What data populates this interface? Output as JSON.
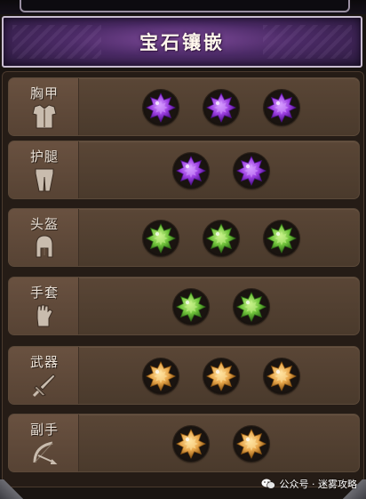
{
  "header": {
    "title": "宝石镶嵌"
  },
  "slots": [
    {
      "name": "胸甲",
      "icon": "chest-armor-icon",
      "gems": [
        "purple",
        "purple",
        "purple"
      ]
    },
    {
      "name": "护腿",
      "icon": "leg-armor-icon",
      "gems": [
        "purple",
        "purple"
      ]
    },
    {
      "name": "头盔",
      "icon": "helmet-icon",
      "gems": [
        "green",
        "green",
        "green"
      ]
    },
    {
      "name": "手套",
      "icon": "glove-icon",
      "gems": [
        "green",
        "green"
      ]
    },
    {
      "name": "武器",
      "icon": "sword-icon",
      "gems": [
        "gold",
        "gold",
        "gold"
      ]
    },
    {
      "name": "副手",
      "icon": "bow-icon",
      "gems": [
        "gold",
        "gold"
      ]
    }
  ],
  "gem_colors": {
    "purple": {
      "light": "#d59bff",
      "mid": "#9b3ee0",
      "dark": "#4e1288"
    },
    "green": {
      "light": "#c9f28a",
      "mid": "#6fc23a",
      "dark": "#2f6a18"
    },
    "gold": {
      "light": "#ffe3a0",
      "mid": "#e7a64a",
      "dark": "#8a5514"
    }
  },
  "watermark": {
    "text": "公众号 · 迷雾攻略",
    "icon": "wechat-icon"
  }
}
